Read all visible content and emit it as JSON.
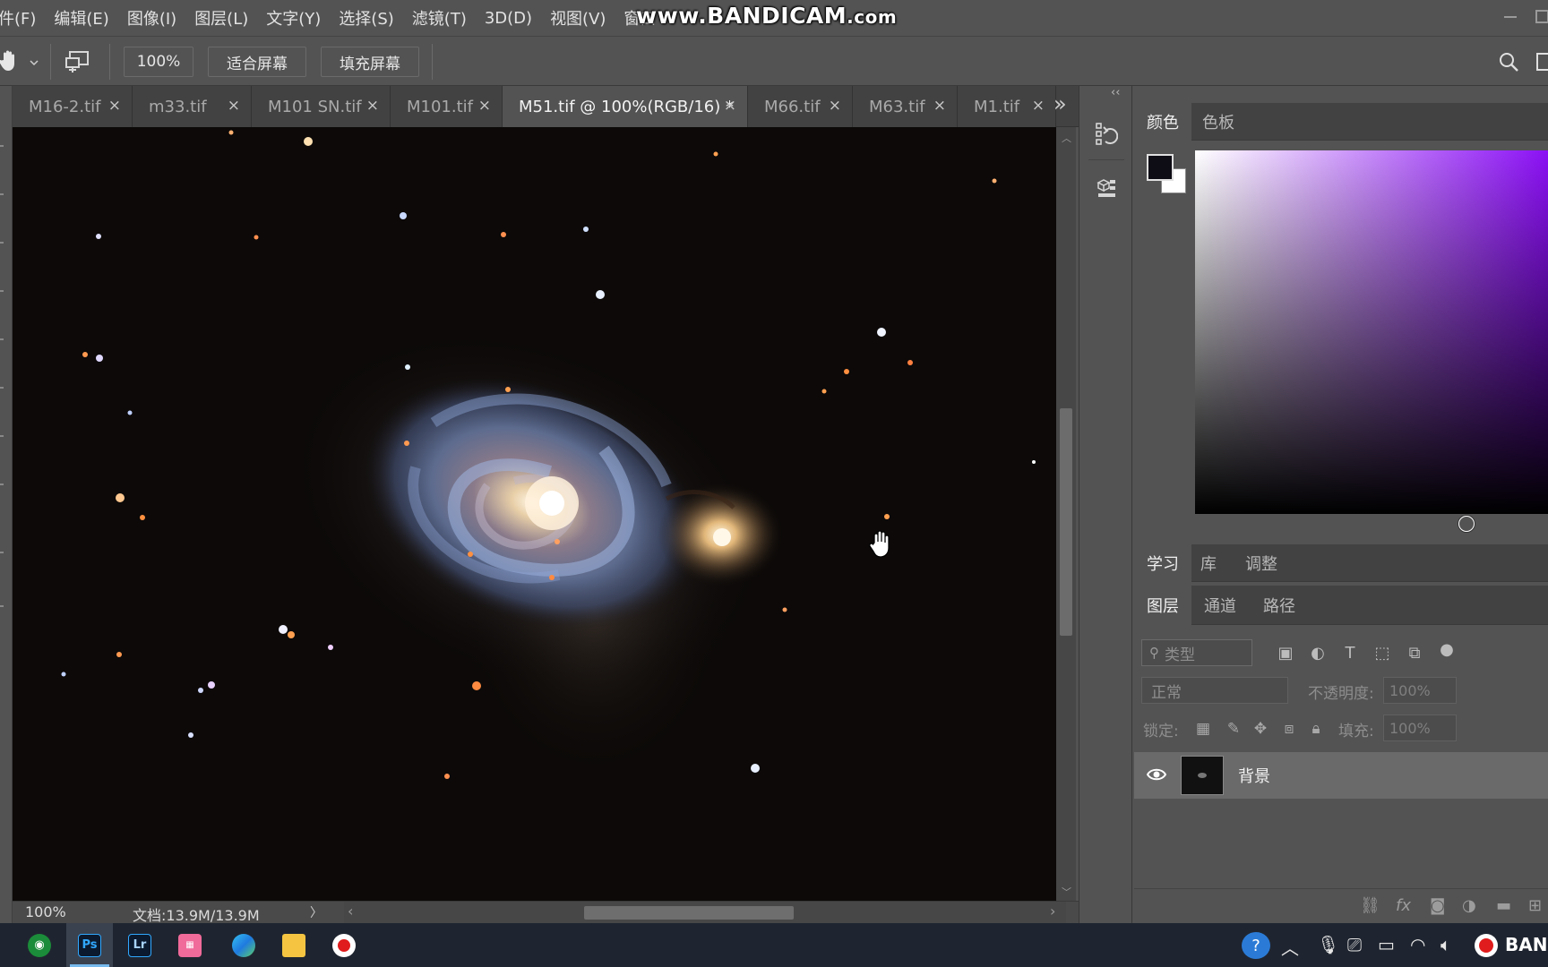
{
  "menu": {
    "items": [
      "件(F)",
      "编辑(E)",
      "图像(I)",
      "图层(L)",
      "文字(Y)",
      "选择(S)",
      "滤镜(T)",
      "3D(D)",
      "视图(V)",
      "窗口"
    ]
  },
  "watermark": {
    "main": "www.BANDICAM",
    "suffix": ".com"
  },
  "options": {
    "zoom": "100%",
    "fit_screen": "适合屏幕",
    "fill_screen": "填充屏幕"
  },
  "tabs": [
    {
      "label": "M16-2.tif",
      "close": "×"
    },
    {
      "label": "m33.tif",
      "close": "×"
    },
    {
      "label": "M101 SN.tif",
      "close": "×"
    },
    {
      "label": "M101.tif",
      "close": "×"
    },
    {
      "label": "M51.tif @ 100%(RGB/16) *",
      "close": "×"
    },
    {
      "label": "M66.tif",
      "close": "×"
    },
    {
      "label": "M63.tif",
      "close": "×"
    },
    {
      "label": "M1.tif",
      "close": "×"
    }
  ],
  "tab_overflow": "»",
  "status": {
    "zoom": "100%",
    "doc": "文档:13.9M/13.9M",
    "arrow": "〉"
  },
  "color_panel": {
    "tabs": [
      "颜色",
      "色板"
    ],
    "foreground": "#0e0c14",
    "background": "#ffffff",
    "hue": "#8b10f5"
  },
  "learn_panel": {
    "tabs": [
      "学习",
      "库",
      "调整"
    ]
  },
  "layers_panel": {
    "tabs": [
      "图层",
      "通道",
      "路径"
    ],
    "filter_placeholder": "类型",
    "blend_mode": "正常",
    "opacity_label": "不透明度:",
    "opacity_value": "100%",
    "lock_label": "锁定:",
    "fill_label": "填充:",
    "fill_value": "100%",
    "layers": [
      {
        "name": "背景",
        "visible": true
      }
    ]
  },
  "taskbar": {
    "apps": [
      "app-green",
      "Ps",
      "Lr",
      "app-pink",
      "edge",
      "explorer",
      "bandicam"
    ],
    "tray_label": "BAN"
  }
}
